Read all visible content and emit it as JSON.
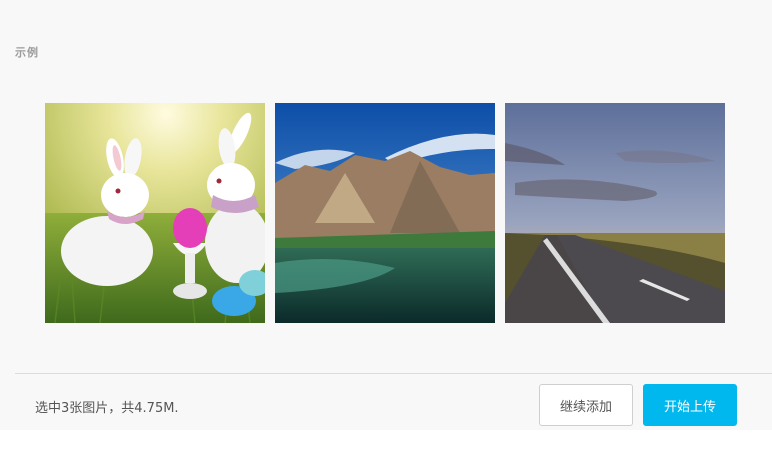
{
  "section": {
    "label": "示例"
  },
  "thumbnails": [
    {
      "name": "easter-bunnies-photo",
      "icon": "photo-easter-bunnies"
    },
    {
      "name": "mountain-lake-photo",
      "icon": "photo-mountain-lake"
    },
    {
      "name": "road-sunset-photo",
      "icon": "photo-road-sunset"
    }
  ],
  "footer": {
    "status_text": "选中3张图片，共4.75M.",
    "continue_label": "继续添加",
    "start_label": "开始上传"
  },
  "colors": {
    "accent": "#00b7ee",
    "panel_bg": "#f8f8f8",
    "text": "#555555"
  }
}
